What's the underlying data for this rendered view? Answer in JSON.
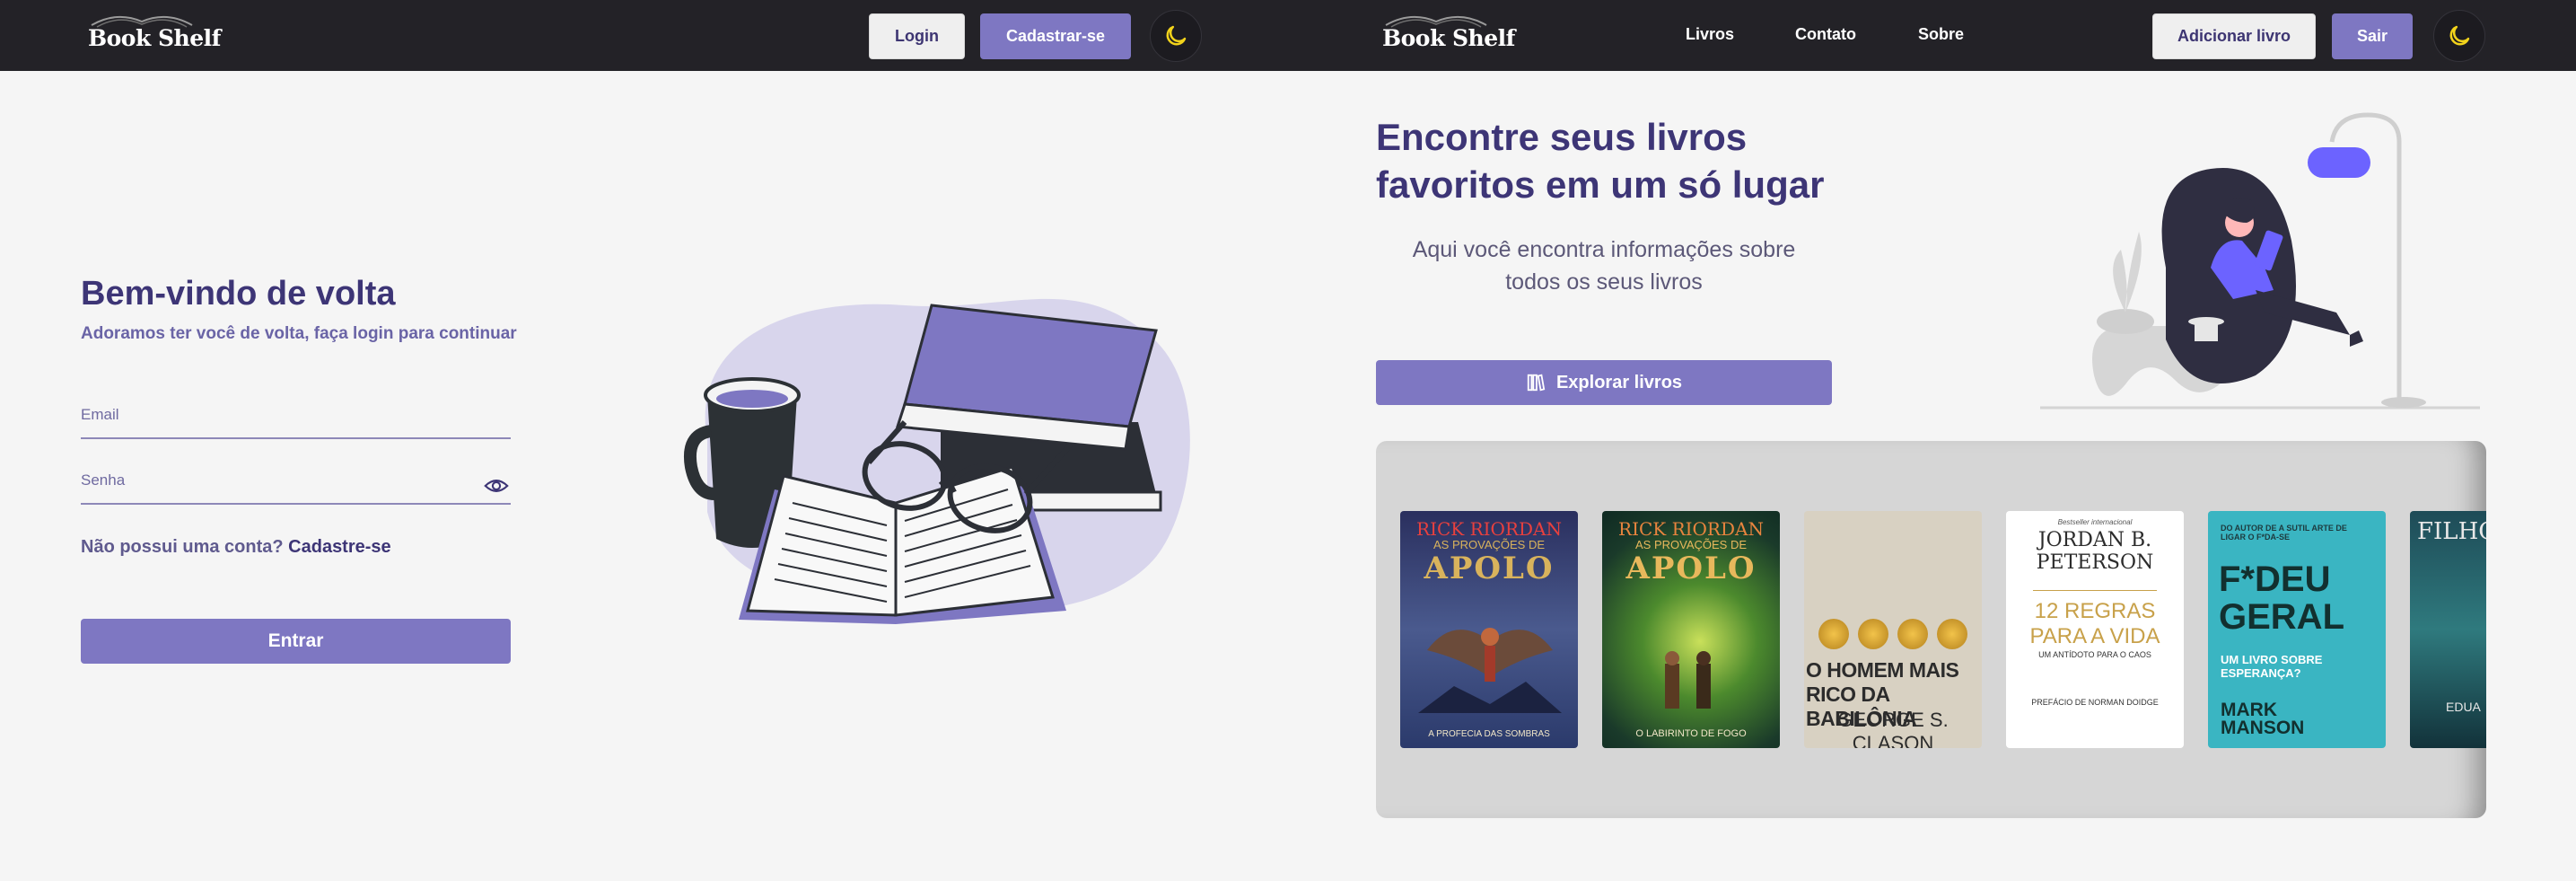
{
  "login_page": {
    "nav": {
      "logo": "Book Shelf",
      "login_button": "Login",
      "signup_button": "Cadastrar-se"
    },
    "heading": "Bem-vindo de volta",
    "subheading": "Adoramos ter você de volta, faça login para continuar",
    "email": {
      "label": "Email",
      "value": ""
    },
    "password": {
      "label": "Senha",
      "value": ""
    },
    "no_account_text": "Não possui uma conta?",
    "signup_link": "Cadastre-se",
    "submit_button": "Entrar"
  },
  "home_page": {
    "nav": {
      "logo": "Book Shelf",
      "links": [
        "Livros",
        "Contato",
        "Sobre"
      ],
      "add_book_button": "Adicionar livro",
      "logout_button": "Sair"
    },
    "hero_title_line1": "Encontre seus livros",
    "hero_title_line2": "favoritos em um só lugar",
    "hero_subtitle_line1": "Aqui você encontra informações sobre",
    "hero_subtitle_line2": "todos os seus livros",
    "explore_button": "Explorar livros",
    "books": [
      {
        "author": "RICK RIORDAN",
        "title": "AS PROVAÇÕES DE",
        "series": "APOLO",
        "subtitle": "A PROFECIA DAS SOMBRAS",
        "bg": "#2b3a6b"
      },
      {
        "author": "RICK RIORDAN",
        "title": "AS PROVAÇÕES DE",
        "series": "APOLO",
        "subtitle": "O LABIRINTO DE FOGO",
        "bg": "#1f4a2e"
      },
      {
        "title": "O HOMEM MAIS RICO DA BABILÔNIA",
        "author": "GEORGE S. CLASON",
        "bg": "#d9d2c4"
      },
      {
        "tag": "Bestseller internacional",
        "author_line1": "JORDAN B.",
        "author_line2": "PETERSON",
        "title_line1": "12 REGRAS",
        "title_line2": "PARA A VIDA",
        "subtitle": "UM ANTÍDOTO PARA O CAOS",
        "preface": "PREFÁCIO DE NORMAN DOIDGE",
        "bg": "#ffffff"
      },
      {
        "pre": "DO AUTOR DE A SUTIL ARTE DE LIGAR O F*DA-SE",
        "title_line1": "F*DEU",
        "title_line2": "GERAL",
        "subtitle": "UM LIVRO SOBRE ESPERANÇA?",
        "author_line1": "MARK",
        "author_line2": "MANSON",
        "bg": "#3ab5c2"
      },
      {
        "title": "FILHO",
        "author": "EDUA",
        "bg": "#1e4b57"
      }
    ]
  },
  "colors": {
    "navbar": "#232227",
    "primary": "#7e77c2",
    "heading": "#3d3576",
    "background": "#f5f5f5",
    "moon": "#f2d31b"
  }
}
